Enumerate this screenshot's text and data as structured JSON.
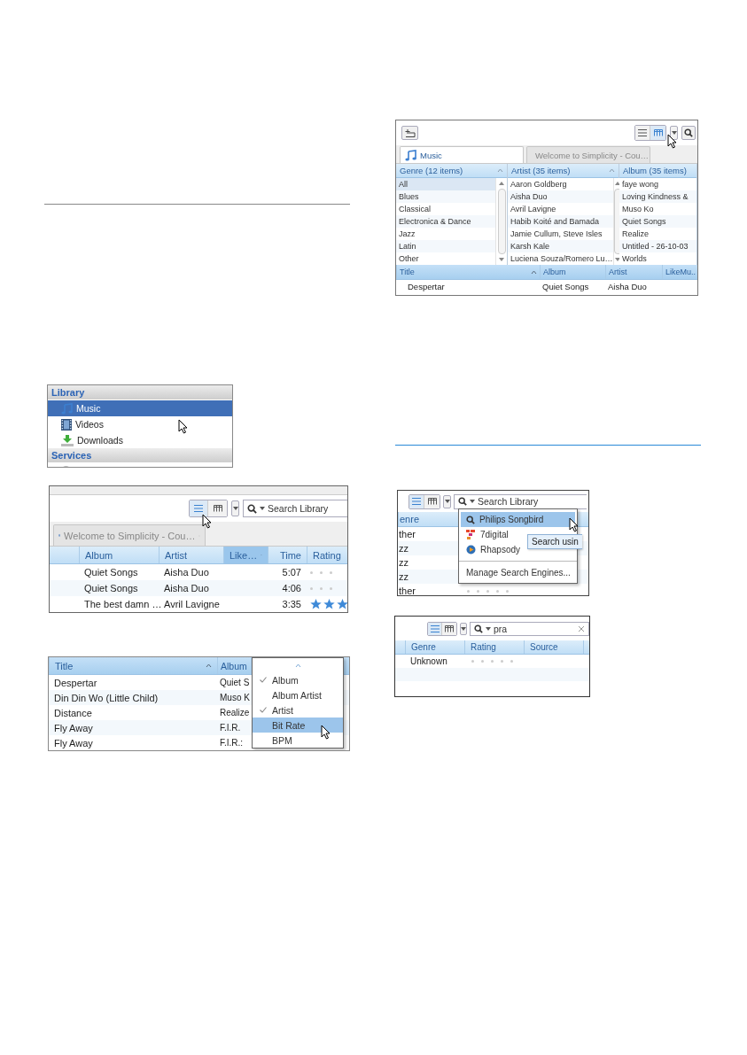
{
  "library_panel": {
    "title": "Library",
    "items": [
      {
        "label": "Music",
        "kind": "music",
        "selected": true
      },
      {
        "label": "Videos",
        "kind": "video",
        "selected": false
      },
      {
        "label": "Downloads",
        "kind": "download",
        "selected": false
      }
    ],
    "services_title": "Services"
  },
  "list_view_screen": {
    "view_modes": [
      {
        "kind": "list",
        "selected": true
      },
      {
        "kind": "columns",
        "selected": false
      }
    ],
    "search_placeholder": "Search Library",
    "tab": "Welcome to Simplicity - Cou…",
    "columns": [
      {
        "label": "Album",
        "selected": false
      },
      {
        "label": "Artist",
        "selected": false
      },
      {
        "label": "Like…",
        "selected": true
      },
      {
        "label": "Time",
        "selected": false
      },
      {
        "label": "Rating",
        "selected": false
      }
    ],
    "rows": [
      {
        "album": "Quiet Songs",
        "artist": "Aisha Duo",
        "time": "5:07",
        "stars": 0
      },
      {
        "album": "Quiet Songs",
        "artist": "Aisha Duo",
        "time": "4:06",
        "stars": 0
      },
      {
        "album": "The best damn …",
        "artist": "Avril Lavigne",
        "time": "3:35",
        "stars": 3
      }
    ]
  },
  "column_menu_screen": {
    "columns": [
      "Title",
      "Album"
    ],
    "rows": [
      {
        "title": "Despertar",
        "album": "Quiet S"
      },
      {
        "title": "Din Din Wo (Little Child)",
        "album": "Muso K"
      },
      {
        "title": "Distance",
        "album": "Realize"
      },
      {
        "title": "Fly Away",
        "album": "F.I.R."
      },
      {
        "title": "Fly Away",
        "album": "F.I.R.:"
      }
    ],
    "menu": [
      {
        "label": "Album",
        "checked": true,
        "selected": false
      },
      {
        "label": "Album Artist",
        "checked": false,
        "selected": false
      },
      {
        "label": "Artist",
        "checked": true,
        "selected": false
      },
      {
        "label": "Bit Rate",
        "checked": false,
        "selected": true
      },
      {
        "label": "BPM",
        "checked": false,
        "selected": false
      }
    ]
  },
  "filter_pane_screen": {
    "view_modes": [
      {
        "kind": "list",
        "selected": false
      },
      {
        "kind": "columns",
        "selected": true
      }
    ],
    "tabs": [
      {
        "label": "Music",
        "kind": "music",
        "selected": true
      },
      {
        "label": "Welcome to Simplicity - Cou…",
        "kind": "web",
        "selected": false
      }
    ],
    "panes": [
      {
        "title": "Genre (12 items)",
        "items": [
          {
            "label": "All",
            "selected": true
          },
          {
            "label": "Blues",
            "selected": false
          },
          {
            "label": "Classical",
            "selected": false
          },
          {
            "label": "Electronica & Dance",
            "selected": false
          },
          {
            "label": "Jazz",
            "selected": false
          },
          {
            "label": "Latin",
            "selected": false
          },
          {
            "label": "Other",
            "selected": false
          }
        ]
      },
      {
        "title": "Artist (35 items)",
        "items": [
          {
            "label": "Aaron Goldberg",
            "selected": false
          },
          {
            "label": "Aisha Duo",
            "selected": false
          },
          {
            "label": "Avril Lavigne",
            "selected": false
          },
          {
            "label": "Habib Koité and Bamada",
            "selected": false
          },
          {
            "label": "Jamie Cullum, Steve Isles",
            "selected": false
          },
          {
            "label": "Karsh Kale",
            "selected": false
          },
          {
            "label": "Luciena Souza/Romero Lu…",
            "selected": false
          }
        ]
      },
      {
        "title": "Album (35 items)",
        "items": [
          {
            "label": "faye wong",
            "selected": false
          },
          {
            "label": "Loving Kindness &",
            "selected": false
          },
          {
            "label": "Muso Ko",
            "selected": false
          },
          {
            "label": "Quiet Songs",
            "selected": false
          },
          {
            "label": "Realize",
            "selected": false
          },
          {
            "label": "Untitled - 26-10-03",
            "selected": false
          },
          {
            "label": "Worlds",
            "selected": false
          }
        ]
      }
    ],
    "columns": [
      "Title",
      "Album",
      "Artist",
      "LikeMu.."
    ],
    "rows": [
      {
        "title": "Despertar",
        "album": "Quiet Songs",
        "artist": "Aisha Duo"
      }
    ]
  },
  "search_engine_screen": {
    "view_modes": [
      {
        "kind": "list",
        "selected": true
      },
      {
        "kind": "columns",
        "selected": false
      }
    ],
    "search_placeholder": "Search Library",
    "column_1": "enre",
    "rows": [
      {
        "text": "ther"
      },
      {
        "text": "zz"
      },
      {
        "text": "zz"
      },
      {
        "text": "zz"
      },
      {
        "text": "ther",
        "stars": 0
      }
    ],
    "engines": [
      {
        "label": "Philips Songbird",
        "kind": "songbird",
        "selected": true
      },
      {
        "label": "7digital",
        "kind": "digital",
        "selected": false
      },
      {
        "label": "Rhapsody",
        "kind": "rhapsody",
        "selected": false
      }
    ],
    "manage": "Manage Search Engines...",
    "tooltip": "Search usin"
  },
  "search_result_screen": {
    "view_modes": [
      {
        "kind": "list",
        "selected": true
      },
      {
        "kind": "columns",
        "selected": false
      }
    ],
    "search_value": "pra",
    "columns": [
      "Genre",
      "Rating",
      "Source"
    ],
    "rows": [
      {
        "genre": "Unknown",
        "stars": 0
      }
    ]
  }
}
